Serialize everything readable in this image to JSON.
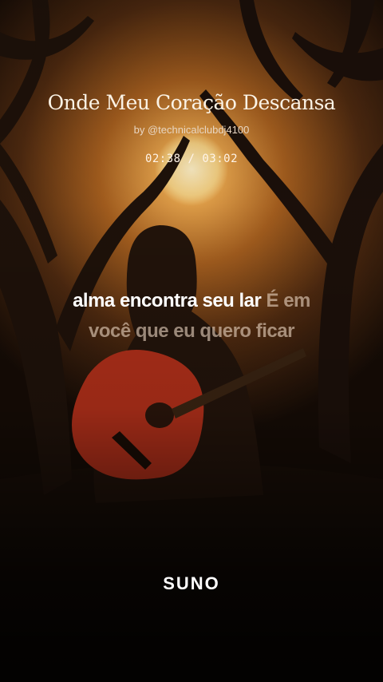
{
  "song": {
    "title": "Onde Meu Coração Descansa",
    "artist": "by @technicalclubdj4100",
    "time": "02:38 / 03:02"
  },
  "lyrics": {
    "line1_sung": "alma encontra seu lar",
    "line1_unsung": "É em",
    "line2_unsung": "você que eu quero ficar"
  },
  "brand": {
    "name": "SUNO"
  },
  "colors": {
    "sun": "#f7c46a",
    "sky_dark": "#2b1a0c",
    "guitar": "#c02a14"
  }
}
